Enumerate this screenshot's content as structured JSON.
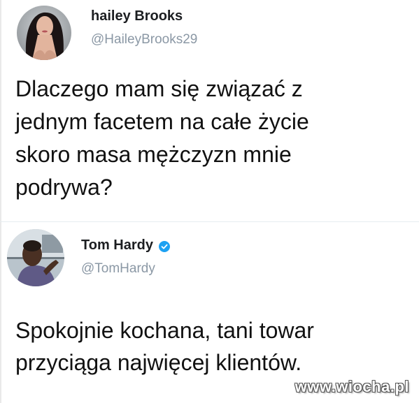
{
  "tweets": [
    {
      "display_name": "hailey Brooks",
      "handle": "@HaileyBrooks29",
      "text": "Dlaczego mam się związać z\njednym facetem na całe życie\nskoro masa mężczyzn mnie\npodrywa?",
      "verified": false
    },
    {
      "display_name": "Tom Hardy",
      "handle": "@TomHardy",
      "text": "Spokojnie kochana, tani towar\nprzyciąga najwięcej klientów.",
      "verified": true
    }
  ],
  "watermark": "www.wiocha.pl",
  "colors": {
    "handle": "#8b98a5",
    "verified": "#1da1f2",
    "text": "#111111"
  }
}
